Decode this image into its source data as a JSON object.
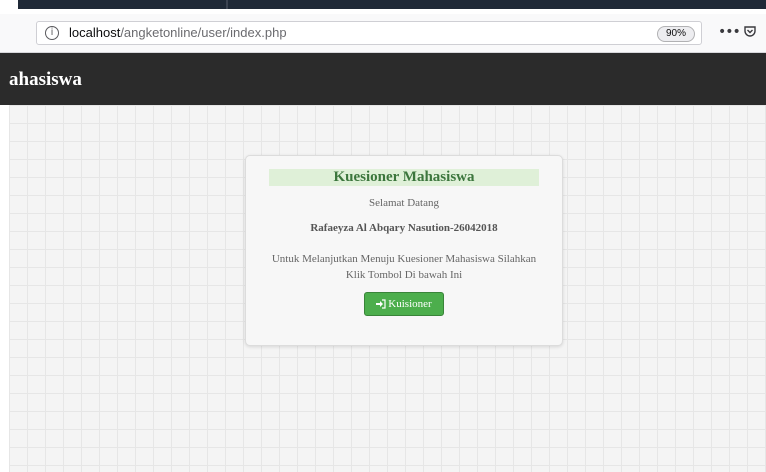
{
  "browser": {
    "url_host": "localhost",
    "url_path": "/angketonline/user/index.php",
    "zoom": "90%",
    "info_icon": "i",
    "more_icon": "•••"
  },
  "header": {
    "brand": "ahasiswa"
  },
  "card": {
    "title": "Kuesioner Mahasiswa",
    "greeting": "Selamat Datang",
    "user_name": "Rafaeyza Al Abqary Nasution-26042018",
    "instruction": "Untuk Melanjutkan Menuju Kuesioner Mahasiswa Silahkan Klik Tombol Di bawah Ini",
    "button_label": "Kuisioner"
  },
  "colors": {
    "header_bg": "#2b2b2b",
    "title_bg": "#dff0d8",
    "title_text": "#3c763d",
    "button_bg": "#4cae4c"
  },
  "icons": [
    "info-icon",
    "more-icon",
    "pocket-icon",
    "sign-in-icon"
  ]
}
